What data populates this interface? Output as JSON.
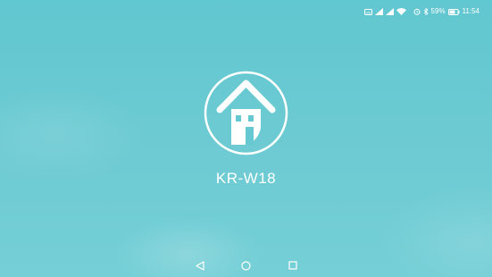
{
  "status_bar": {
    "icons": [
      "hd-icon",
      "signal-icon",
      "signal-icon",
      "wifi-icon",
      "alarm-icon",
      "bluetooth-icon",
      "battery-icon"
    ],
    "battery_percent_label": "59%",
    "time": "11:54"
  },
  "app": {
    "name": "KR-W18",
    "logo_icon": "house-icon"
  },
  "nav_bar": {
    "back_icon": "back-triangle-icon",
    "home_icon": "home-circle-icon",
    "recents_icon": "recents-square-icon"
  },
  "colors": {
    "background": "#66c9d1",
    "foreground": "#ffffff"
  }
}
